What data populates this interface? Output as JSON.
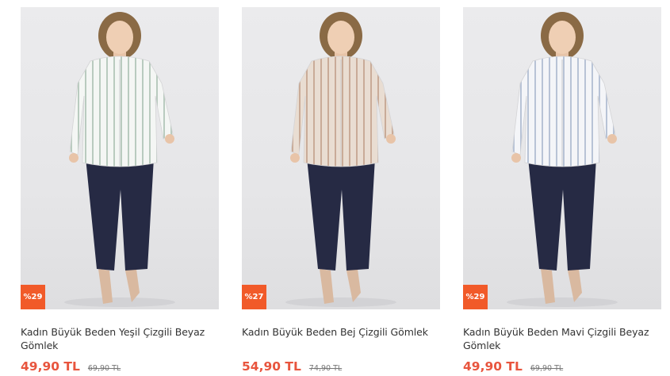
{
  "products": [
    {
      "name": "Kadın Büyük Beden Yeşil Çizgili Beyaz Gömlek",
      "price": "49,90 TL",
      "old_price": "69,90 TL",
      "discount": "%29",
      "shirt_color": "#f4f6f4",
      "stripe_color": "#b9cbbf"
    },
    {
      "name": "Kadın Büyük Beden Bej Çizgili Gömlek",
      "price": "54,90 TL",
      "old_price": "74,90 TL",
      "discount": "%27",
      "shirt_color": "#e9ddd2",
      "stripe_color": "#c9ab98"
    },
    {
      "name": "Kadın Büyük Beden Mavi Çizgili Beyaz Gömlek",
      "price": "49,90 TL",
      "old_price": "69,90 TL",
      "discount": "%29",
      "shirt_color": "#f4f5f8",
      "stripe_color": "#b8c3d6"
    }
  ],
  "colors": {
    "accent": "#f15a29",
    "price": "#e8553e",
    "pants": "#262a44"
  }
}
